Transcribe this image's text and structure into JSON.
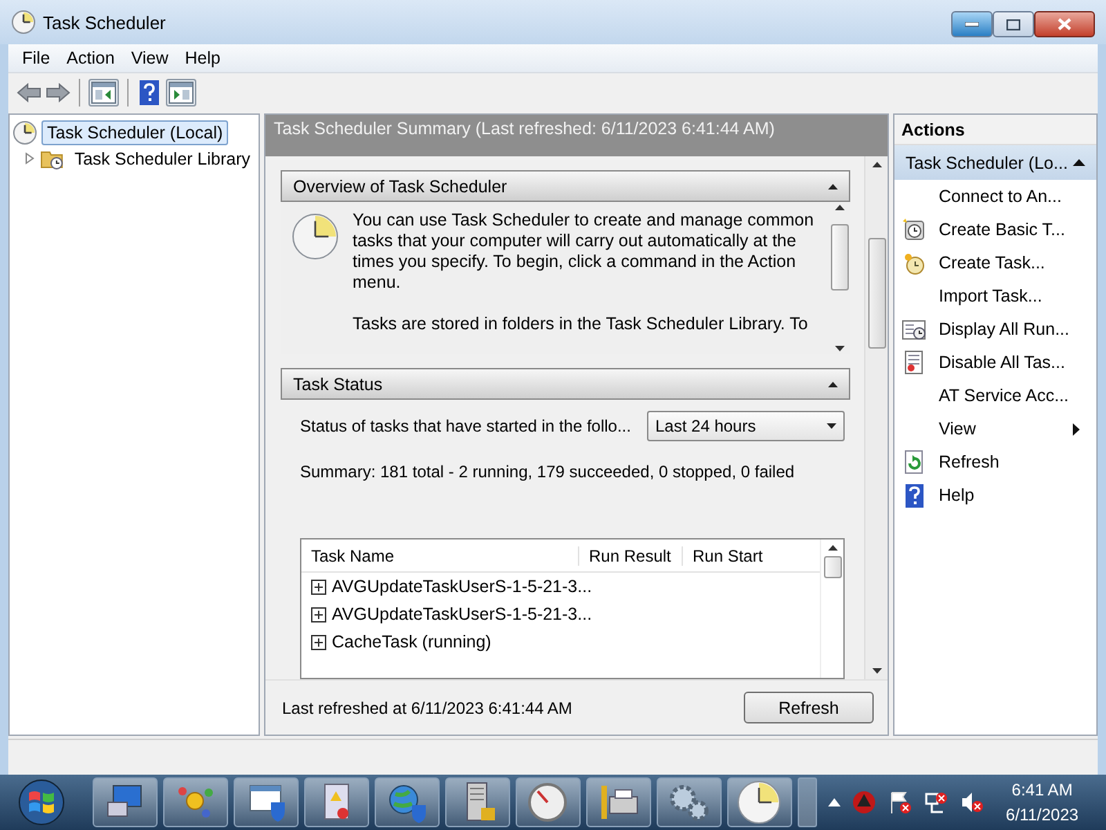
{
  "window": {
    "title": "Task Scheduler"
  },
  "menu": [
    "File",
    "Action",
    "View",
    "Help"
  ],
  "tree": [
    {
      "label": "Task Scheduler (Local)",
      "selected": true,
      "children": [
        {
          "label": "Task Scheduler Library",
          "selected": false,
          "expanded": false
        }
      ]
    }
  ],
  "summary": {
    "header": "Task Scheduler Summary (Last refreshed: 6/11/2023 6:41:44 AM)",
    "overview": {
      "title": "Overview of Task Scheduler",
      "expanded": true,
      "paragraphs": [
        "You can use Task Scheduler to create and manage common tasks that your computer will carry out automatically at the times you specify. To begin, click a command in the Action menu.",
        "Tasks are stored in folders in the Task Scheduler Library. To"
      ]
    },
    "task_status": {
      "title": "Task Status",
      "expanded": true,
      "status_label": "Status of tasks that have started in the follo...",
      "period": "Last 24 hours",
      "summary": "Summary: 181 total - 2 running, 179 succeeded, 0 stopped, 0 failed",
      "table": {
        "columns": [
          "Task Name",
          "Run Result",
          "Run Start"
        ],
        "rows": [
          {
            "name": "AVGUpdateTaskUserS-1-5-21-3...",
            "expanded": false
          },
          {
            "name": "AVGUpdateTaskUserS-1-5-21-3...",
            "expanded": false
          },
          {
            "name": "CacheTask (running)",
            "expanded": false
          }
        ]
      }
    },
    "footer": {
      "text": "Last refreshed at 6/11/2023 6:41:44 AM",
      "button": "Refresh"
    }
  },
  "actions": {
    "title": "Actions",
    "group": {
      "title": "Task Scheduler (Lo...",
      "expanded": true
    },
    "items": [
      {
        "label": "Connect to An...",
        "kind": "command"
      },
      {
        "label": "Create Basic T...",
        "kind": "command"
      },
      {
        "label": "Create Task...",
        "kind": "command"
      },
      {
        "label": "Import Task...",
        "kind": "command"
      },
      {
        "label": "Display All Run...",
        "kind": "command"
      },
      {
        "label": "Disable All Tas...",
        "kind": "command"
      },
      {
        "label": "AT Service Acc...",
        "kind": "command"
      },
      {
        "label": "View",
        "kind": "submenu"
      },
      {
        "label": "Refresh",
        "kind": "command"
      },
      {
        "label": "Help",
        "kind": "command"
      }
    ]
  },
  "taskbar": {
    "time": "6:41 AM",
    "date": "6/11/2023"
  }
}
